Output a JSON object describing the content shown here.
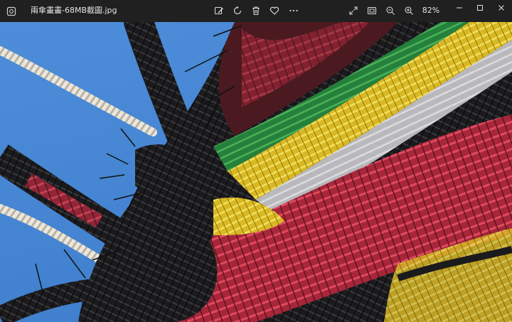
{
  "window": {
    "title": "兩傘畫畫-68MB截圖.jpg",
    "zoom": "82%"
  },
  "toolbar": {
    "edit_icon": "edit-image-icon",
    "rotate_icon": "rotate-icon",
    "delete_icon": "trash-icon",
    "favorite_icon": "heart-icon",
    "more_icon": "more-icon",
    "fullscreen_icon": "expand-icon",
    "fit_icon": "fit-to-window-icon",
    "zoom_out_icon": "zoom-out-icon",
    "zoom_in_icon": "zoom-in-icon"
  },
  "window_controls": {
    "minimize_icon": "minimize-icon",
    "maximize_icon": "maximize-icon",
    "close_icon": "close-icon"
  },
  "colors": {
    "titlebar": "#202020",
    "sky": "#4f8fd8",
    "rope": "#e6e1d6",
    "yarn_red": "#c93343",
    "yarn_yellow": "#e7c72e",
    "yarn_green": "#2f8c3a",
    "yarn_dark": "#1a1a1a"
  }
}
